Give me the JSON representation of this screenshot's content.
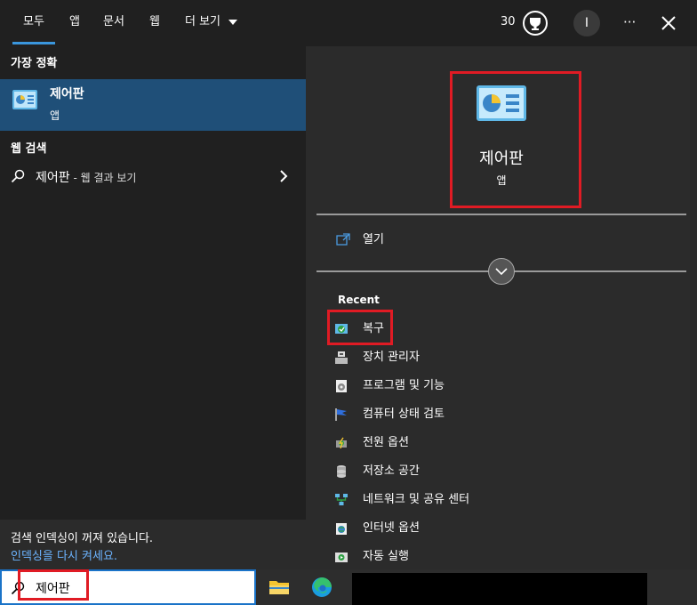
{
  "tabs": [
    {
      "label": "모두",
      "active": true
    },
    {
      "label": "앱"
    },
    {
      "label": "문서"
    },
    {
      "label": "웹"
    },
    {
      "label": "더 보기"
    }
  ],
  "header": {
    "points": "30",
    "profile_initial": "I",
    "more_label": "···"
  },
  "left": {
    "best_match_heading": "가장 정확",
    "best_match": {
      "title": "제어판",
      "subtitle": "앱"
    },
    "web_heading": "웹 검색",
    "web_item": {
      "query": "제어판",
      "suffix": " - 웹 결과 보기"
    },
    "indexing_notice": "검색 인덱싱이 꺼져 있습니다.",
    "indexing_link": "인덱싱을 다시 켜세요."
  },
  "right": {
    "app_title": "제어판",
    "app_type": "앱",
    "open_label": "열기",
    "recent_heading": "Recent",
    "recent_items": [
      {
        "label": "복구",
        "icon": "recovery-icon"
      },
      {
        "label": "장치 관리자",
        "icon": "device-manager-icon"
      },
      {
        "label": "프로그램 및 기능",
        "icon": "programs-features-icon"
      },
      {
        "label": "컴퓨터 상태 검토",
        "icon": "flag-icon"
      },
      {
        "label": "전원 옵션",
        "icon": "power-options-icon"
      },
      {
        "label": "저장소 공간",
        "icon": "storage-spaces-icon"
      },
      {
        "label": "네트워크 및 공유 센터",
        "icon": "network-icon"
      },
      {
        "label": "인터넷 옵션",
        "icon": "internet-options-icon"
      },
      {
        "label": "자동 실행",
        "icon": "autoplay-icon"
      }
    ]
  },
  "taskbar": {
    "search_value": "제어판"
  },
  "colors": {
    "accent": "#3a96dd",
    "highlight": "#e01b24",
    "selected_bg": "#1f4f78",
    "link": "#6cb4ff"
  }
}
